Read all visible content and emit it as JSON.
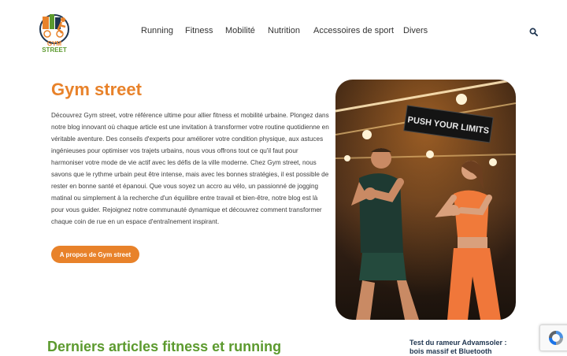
{
  "header": {
    "logo": {
      "icon": "gym-street-logo",
      "line1": "GYM",
      "line2": "STREET"
    },
    "nav": [
      {
        "label": "Running"
      },
      {
        "label": "Fitness"
      },
      {
        "label": "Mobilité"
      },
      {
        "label": "Nutrition"
      },
      {
        "label": "Accessoires de sport"
      },
      {
        "label": "Divers"
      }
    ],
    "search_icon": "search-icon"
  },
  "hero": {
    "title": "Gym street",
    "text": "Découvrez Gym street, votre référence ultime pour allier fitness et mobilité urbaine. Plongez dans notre blog innovant où chaque article est une invitation à transformer votre routine quotidienne en véritable aventure. Des conseils d'experts pour améliorer votre condition physique, aux astuces ingénieuses pour optimiser vos trajets urbains, nous vous offrons tout ce qu'il faut pour harmoniser votre mode de vie actif avec les défis de la ville moderne. Chez Gym street, nous savons que le rythme urbain peut être intense, mais avec les bonnes stratégies, il est possible de rester en bonne santé et épanoui. Que vous soyez un accro au vélo, un passionné de jogging matinal ou simplement à la recherche d'un équilibre entre travail et bien-être, notre blog est là pour vous guider. Rejoignez notre communauté dynamique et découvrez comment transformer chaque coin de rue en un espace d'entraînement inspirant.",
    "button_label": "A propos de Gym street",
    "image_sign_text": "PUSH YOUR LIMITS"
  },
  "latest": {
    "title": "Derniers articles fitness et running",
    "side_article": "Test du rameur Advamsoler : bois massif et Bluetooth"
  },
  "colors": {
    "accent": "#e8822a",
    "green": "#5c9a2e",
    "navy": "#1f3550"
  }
}
